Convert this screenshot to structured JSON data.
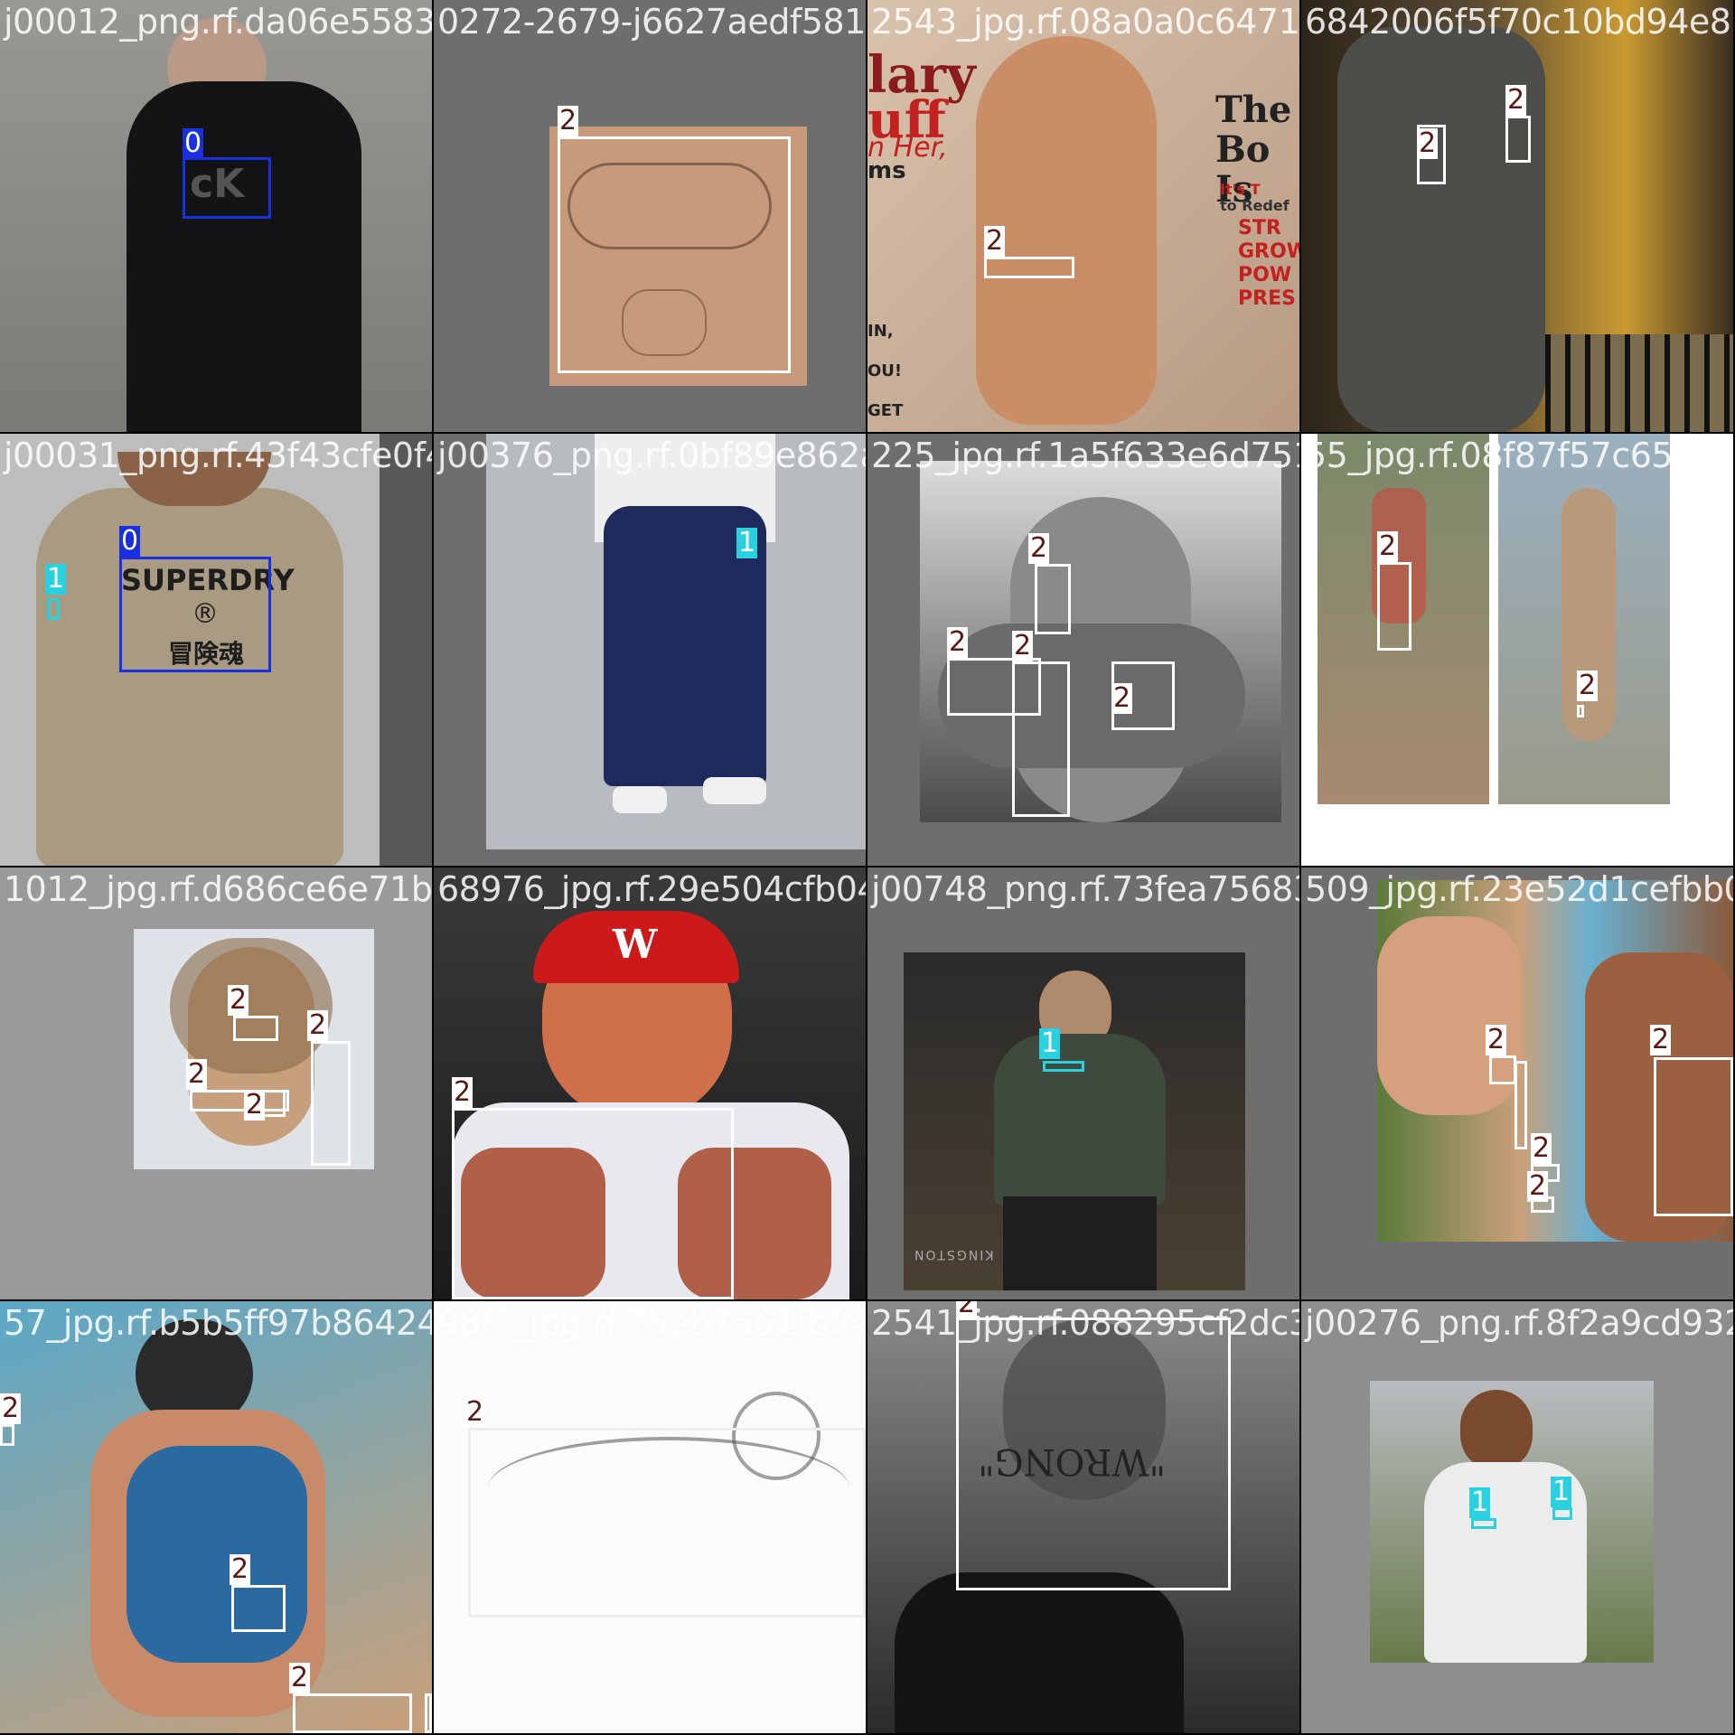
{
  "colors": {
    "class0": "#1a30e0",
    "class1": "#28d0e0",
    "class2": "#ffffff"
  },
  "tiles": [
    {
      "filename": "j00012_png.rf.da06e5583820273-2679-j6627aedf5819535"
    },
    {
      "filename": "0272-2679-j6627aedf58195354_jpg.rf.05e55"
    },
    {
      "filename": "2543_jpg.rf.08a0a0c647139656842006f5f0c10bd94e81"
    },
    {
      "filename": "6842006f5f70c10bd94e81"
    },
    {
      "filename": "j00031_png.rf.43f43cfe0f4c8b00376_png.rf.89e862a0b02"
    },
    {
      "filename": "j00376_png.rf.0bf89e862a0bd225_jpg"
    },
    {
      "filename": "225_jpg.rf.1a5f633e6d751855_jpg.rf.08f057c658d0e"
    },
    {
      "filename": "55_jpg.rf.08f87f57c658d0e"
    },
    {
      "filename": "1012_jpg.rf.d686ce6e71b6968976_jpg.rf.29e50cfb04d8f5c"
    },
    {
      "filename": "68976_jpg.rf.29e504cfb04d8f5cj00748_png.rf.3fea7568308"
    },
    {
      "filename": "j00748_png.rf.73fea756830850c_jpg.rf.23e52d1"
    },
    {
      "filename": "509_jpg.rf.23e52d1cefbb07f65"
    },
    {
      "filename": "57_jpg.rf.b5b5ff97b864247598f5_jpg.rf.75eb7561fb2425c"
    },
    {
      "filename": "98f5_jpg.rf.75eb7561fb2425c2541_jpg.rf.0882"
    },
    {
      "filename": "2541_jpg.rf.088295cf2dc3bbcj00276_png.rf.8f2a9cd93243"
    },
    {
      "filename": "j00276_png.rf.8f2a9cd93243"
    }
  ],
  "labels": {
    "c0": "0",
    "c1": "1",
    "c2": "2"
  },
  "superdry": {
    "line1": "SUPERDRY",
    "reg": "®",
    "line2": "冒険魂"
  },
  "tattoo_text": "\"WRONG\"",
  "ck": "cK",
  "cap_logo": "W",
  "kingston": "KINGSTON",
  "magazine": {
    "name": "lary",
    "sub": "uff",
    "line3": "n Her,",
    "line4": "ms",
    "issue": "The Bo Is",
    "tag1": "It's T",
    "tag2": "to Redef",
    "str": "STR GROWT POW PRES",
    "side": "IN, OU! GET"
  }
}
